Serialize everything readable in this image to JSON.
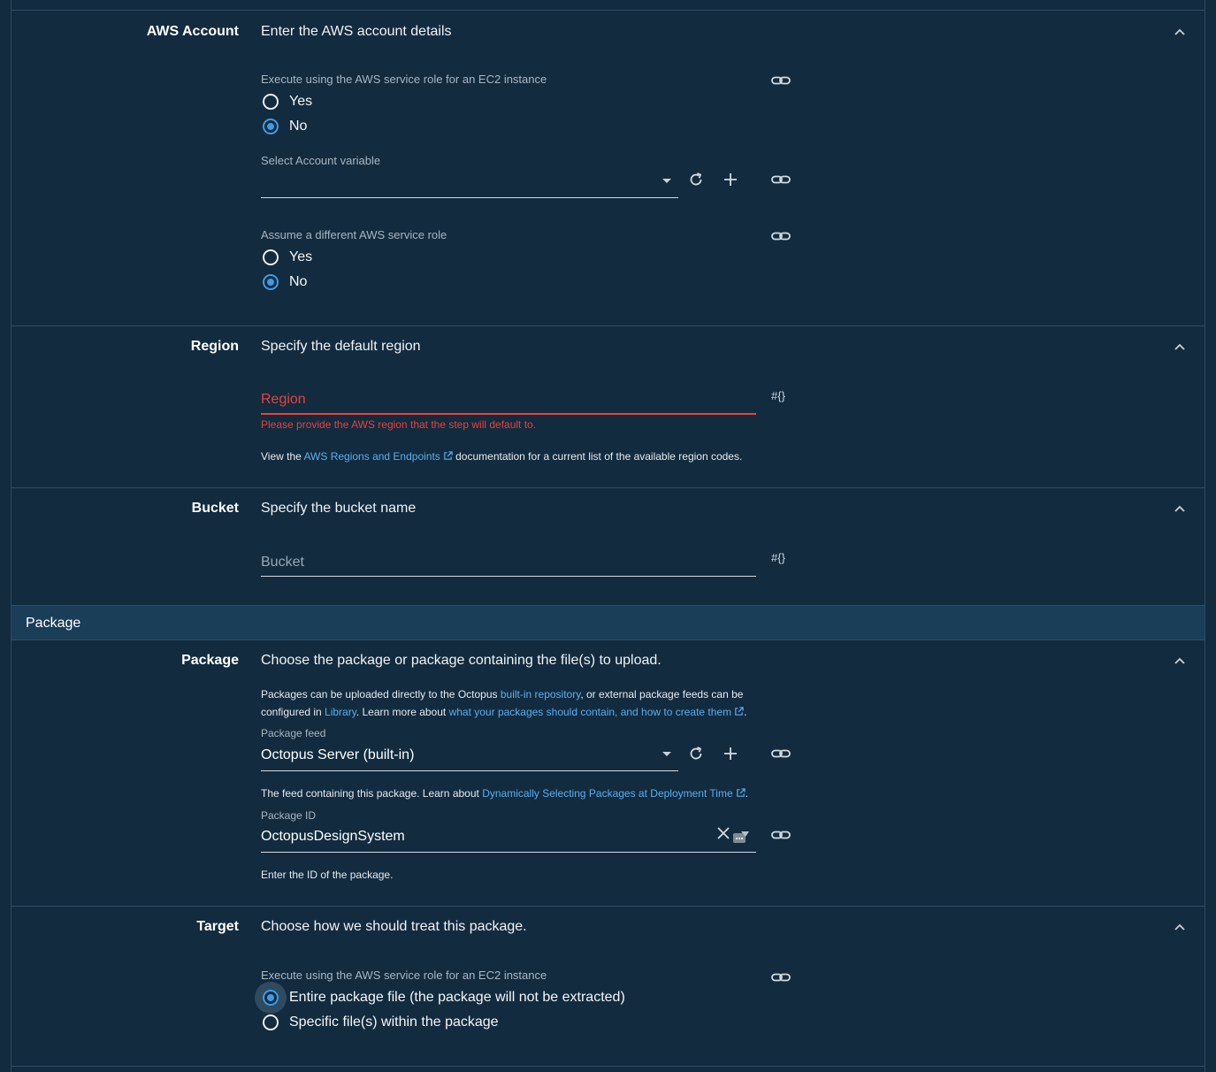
{
  "aws_account": {
    "label": "AWS Account",
    "summary": "Enter the AWS account details",
    "ec2_role_label": "Execute using the AWS service role for an EC2 instance",
    "ec2_options": [
      "Yes",
      "No"
    ],
    "ec2_selected": "No",
    "account_variable_label": "Select Account variable",
    "account_variable_value": "",
    "assume_role_label": "Assume a different AWS service role",
    "assume_options": [
      "Yes",
      "No"
    ],
    "assume_selected": "No"
  },
  "region": {
    "label": "Region",
    "summary": "Specify the default region",
    "placeholder": "Region",
    "error": "Please provide the AWS region that the step will default to.",
    "note_prefix": "View the ",
    "note_link": "AWS Regions and Endpoints",
    "note_suffix": " documentation for a current list of the available region codes.",
    "binding_icon": "#{}"
  },
  "bucket": {
    "label": "Bucket",
    "summary": "Specify the bucket name",
    "placeholder": "Bucket",
    "binding_icon": "#{}"
  },
  "package_group": {
    "title": "Package"
  },
  "package": {
    "label": "Package",
    "summary": "Choose the package or package containing the file(s) to upload.",
    "intro_1": "Packages can be uploaded directly to the Octopus ",
    "intro_link_1": "built-in repository",
    "intro_2": ", or external package feeds can be",
    "intro_3": "configured in ",
    "intro_link_2": "Library",
    "intro_4": ". Learn more about ",
    "intro_link_3": "what your packages should contain, and how to create them",
    "intro_5": ".",
    "feed_label": "Package feed",
    "feed_value": "Octopus Server (built-in)",
    "feed_note_prefix": "The feed containing this package. Learn about ",
    "feed_note_link": "Dynamically Selecting Packages at Deployment Time",
    "feed_note_suffix": ".",
    "id_label": "Package ID",
    "id_value": "OctopusDesignSystem",
    "id_note": "Enter the ID of the package."
  },
  "target": {
    "label": "Target",
    "summary": "Choose how we should treat this package.",
    "field_label": "Execute using the AWS service role for an EC2 instance",
    "options": [
      "Entire package file (the package will not be extracted)",
      "Specific file(s) within the package"
    ],
    "selected": "Entire package file (the package will not be extracted)"
  },
  "colors": {
    "background": "#122b3f",
    "accent": "#3d9ce6",
    "link": "#5aaef0",
    "error": "#e8413c",
    "group_header": "#1a3d58"
  },
  "icons": {
    "chevron": "chevron-up-icon",
    "link": "link-icon",
    "refresh": "refresh-icon",
    "add": "plus-icon",
    "external": "external-link-icon",
    "clear": "close-icon",
    "selector": "variable-selector-icon"
  }
}
